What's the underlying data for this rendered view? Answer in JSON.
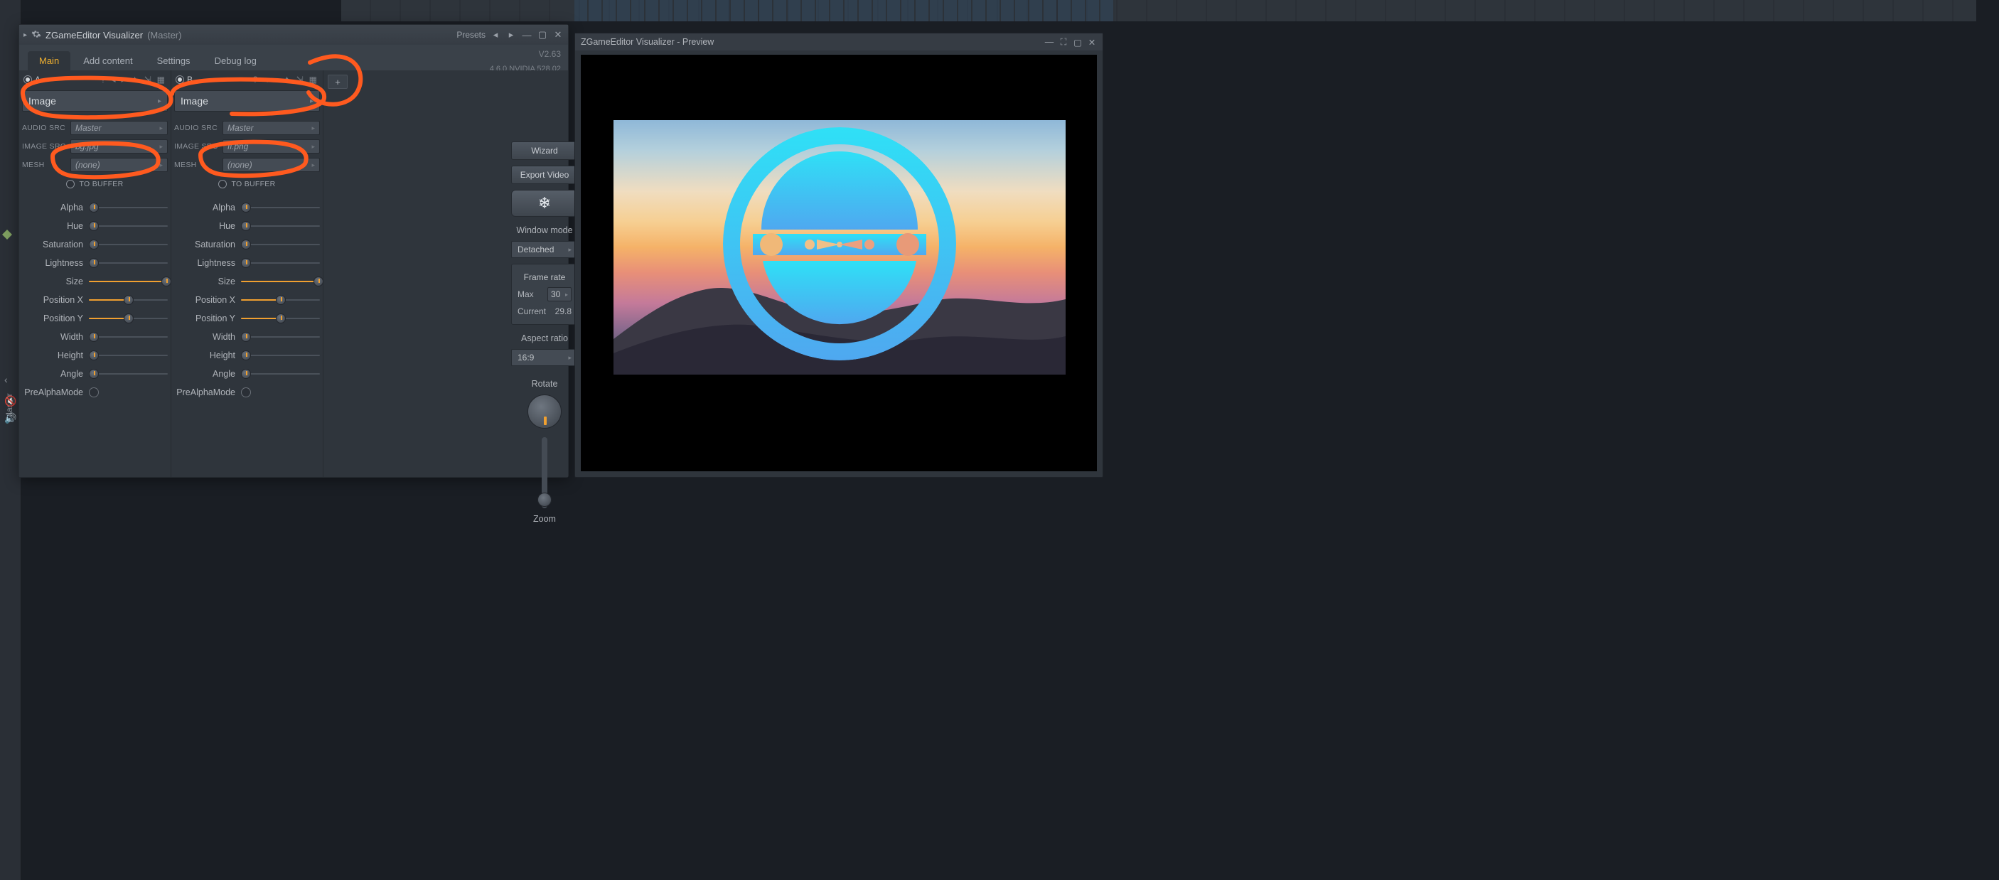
{
  "app": {
    "title": "ZGameEditor Visualizer",
    "title_suffix": "(Master)",
    "presets_label": "Presets",
    "version": "V2.63",
    "driver": "4.6.0 NVIDIA 528.02"
  },
  "tabs": [
    {
      "label": "Main",
      "active": true
    },
    {
      "label": "Add content",
      "active": false
    },
    {
      "label": "Settings",
      "active": false
    },
    {
      "label": "Debug log",
      "active": false
    }
  ],
  "layers": [
    {
      "id": "A",
      "effect": "Image",
      "audio_src": "Master",
      "image_src": "bg.jpg",
      "mesh": "(none)",
      "to_buffer_label": "TO BUFFER",
      "sliders": {
        "Alpha": 0.06,
        "Hue": 0.06,
        "Saturation": 0.06,
        "Lightness": 0.06,
        "Size": 0.98,
        "Position X": 0.5,
        "Position Y": 0.5,
        "Width": 0.06,
        "Height": 0.06,
        "Angle": 0.06
      },
      "prealpha_label": "PreAlphaMode"
    },
    {
      "id": "B",
      "effect": "Image",
      "audio_src": "Master",
      "image_src": "fi.png",
      "mesh": "(none)",
      "to_buffer_label": "TO BUFFER",
      "sliders": {
        "Alpha": 0.06,
        "Hue": 0.06,
        "Saturation": 0.06,
        "Lightness": 0.06,
        "Size": 0.98,
        "Position X": 0.5,
        "Position Y": 0.5,
        "Width": 0.06,
        "Height": 0.06,
        "Angle": 0.06
      },
      "prealpha_label": "PreAlphaMode"
    }
  ],
  "side": {
    "wizard": "Wizard",
    "export": "Export Video",
    "window_mode_label": "Window mode",
    "window_mode": "Detached",
    "frame_rate_label": "Frame rate",
    "max_label": "Max",
    "max_value": "30",
    "current_label": "Current",
    "current_value": "29.8",
    "aspect_label": "Aspect ratio",
    "aspect": "16:9",
    "rotate_label": "Rotate",
    "zoom_label": "Zoom"
  },
  "sliders_order": [
    "Alpha",
    "Hue",
    "Saturation",
    "Lightness",
    "Size",
    "Position X",
    "Position Y",
    "Width",
    "Height",
    "Angle"
  ],
  "field_labels": {
    "audio": "AUDIO SRC",
    "image": "IMAGE SRC",
    "mesh": "MESH"
  },
  "preview": {
    "title": "ZGameEditor Visualizer - Preview"
  },
  "leftbar": {
    "label": "Master"
  }
}
